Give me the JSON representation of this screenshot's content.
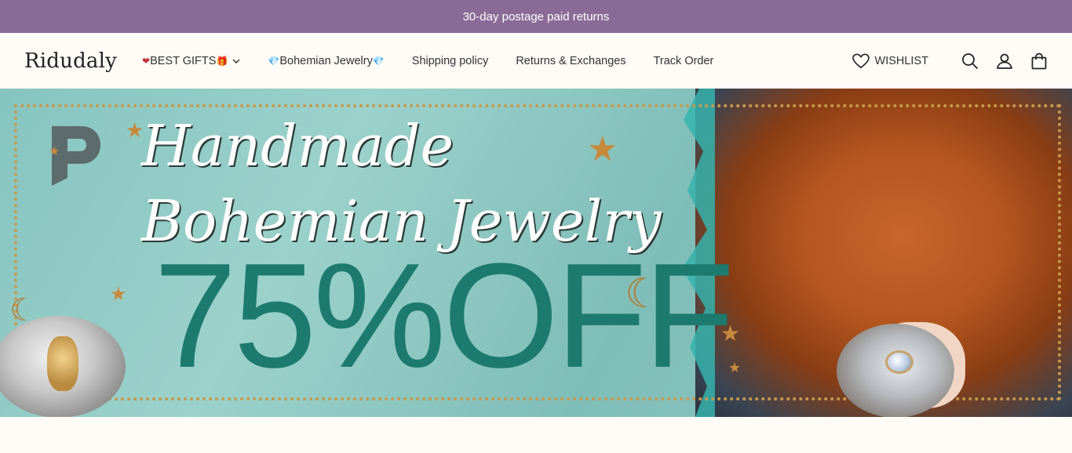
{
  "announcement": {
    "text": "30-day postage paid returns"
  },
  "header": {
    "logo": "Ridudaly",
    "nav": [
      {
        "label": "BEST GIFTS",
        "prefix": "❤",
        "suffix": "🎁",
        "has_dropdown": true
      },
      {
        "label": "Bohemian Jewelry",
        "prefix": "💎",
        "suffix": "💎",
        "has_dropdown": false
      },
      {
        "label": "Shipping policy"
      },
      {
        "label": "Returns & Exchanges"
      },
      {
        "label": "Track Order"
      }
    ],
    "wishlist_label": "WISHLIST",
    "icons": [
      "heart-icon",
      "search-icon",
      "account-icon",
      "cart-icon"
    ]
  },
  "hero": {
    "line1": "Handmade",
    "line2": "Bohemian Jewelry",
    "discount": "75%OFF",
    "colors": {
      "background": "#8fc9c4",
      "discount": "#1d7a6e",
      "frame": "#c79a4c",
      "announcement": "#8a6b97"
    }
  }
}
